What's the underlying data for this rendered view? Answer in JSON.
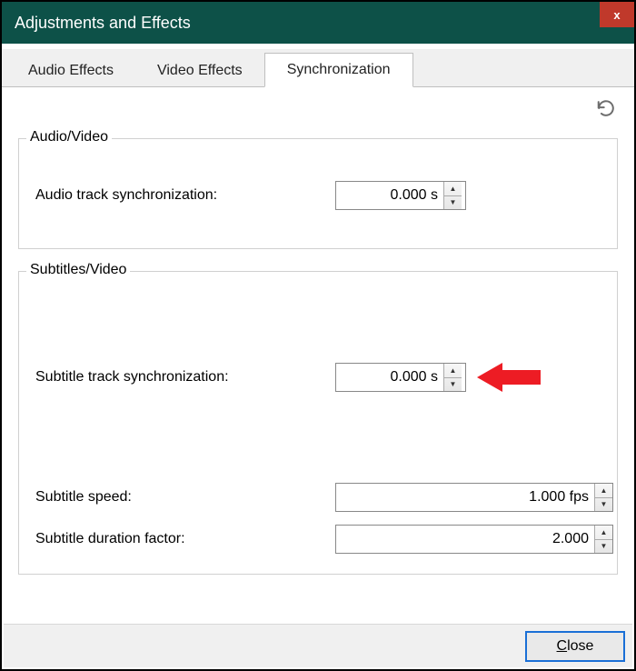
{
  "window": {
    "title": "Adjustments and Effects",
    "close_glyph": "x"
  },
  "tabs": [
    {
      "label": "Audio Effects",
      "active": false
    },
    {
      "label": "Video Effects",
      "active": false
    },
    {
      "label": "Synchronization",
      "active": true
    }
  ],
  "icons": {
    "refresh": "refresh-icon"
  },
  "groups": {
    "audio_video": {
      "legend": "Audio/Video",
      "audio_sync_label": "Audio track synchronization:",
      "audio_sync_value": "0.000 s"
    },
    "subtitles_video": {
      "legend": "Subtitles/Video",
      "subtitle_sync_label": "Subtitle track synchronization:",
      "subtitle_sync_value": "0.000 s",
      "subtitle_speed_label": "Subtitle speed:",
      "subtitle_speed_value": "1.000 fps",
      "subtitle_duration_label": "Subtitle duration factor:",
      "subtitle_duration_value": "2.000"
    }
  },
  "footer": {
    "close_underlined": "C",
    "close_rest": "lose"
  },
  "annotation": {
    "arrow_color": "#ed1c24"
  }
}
